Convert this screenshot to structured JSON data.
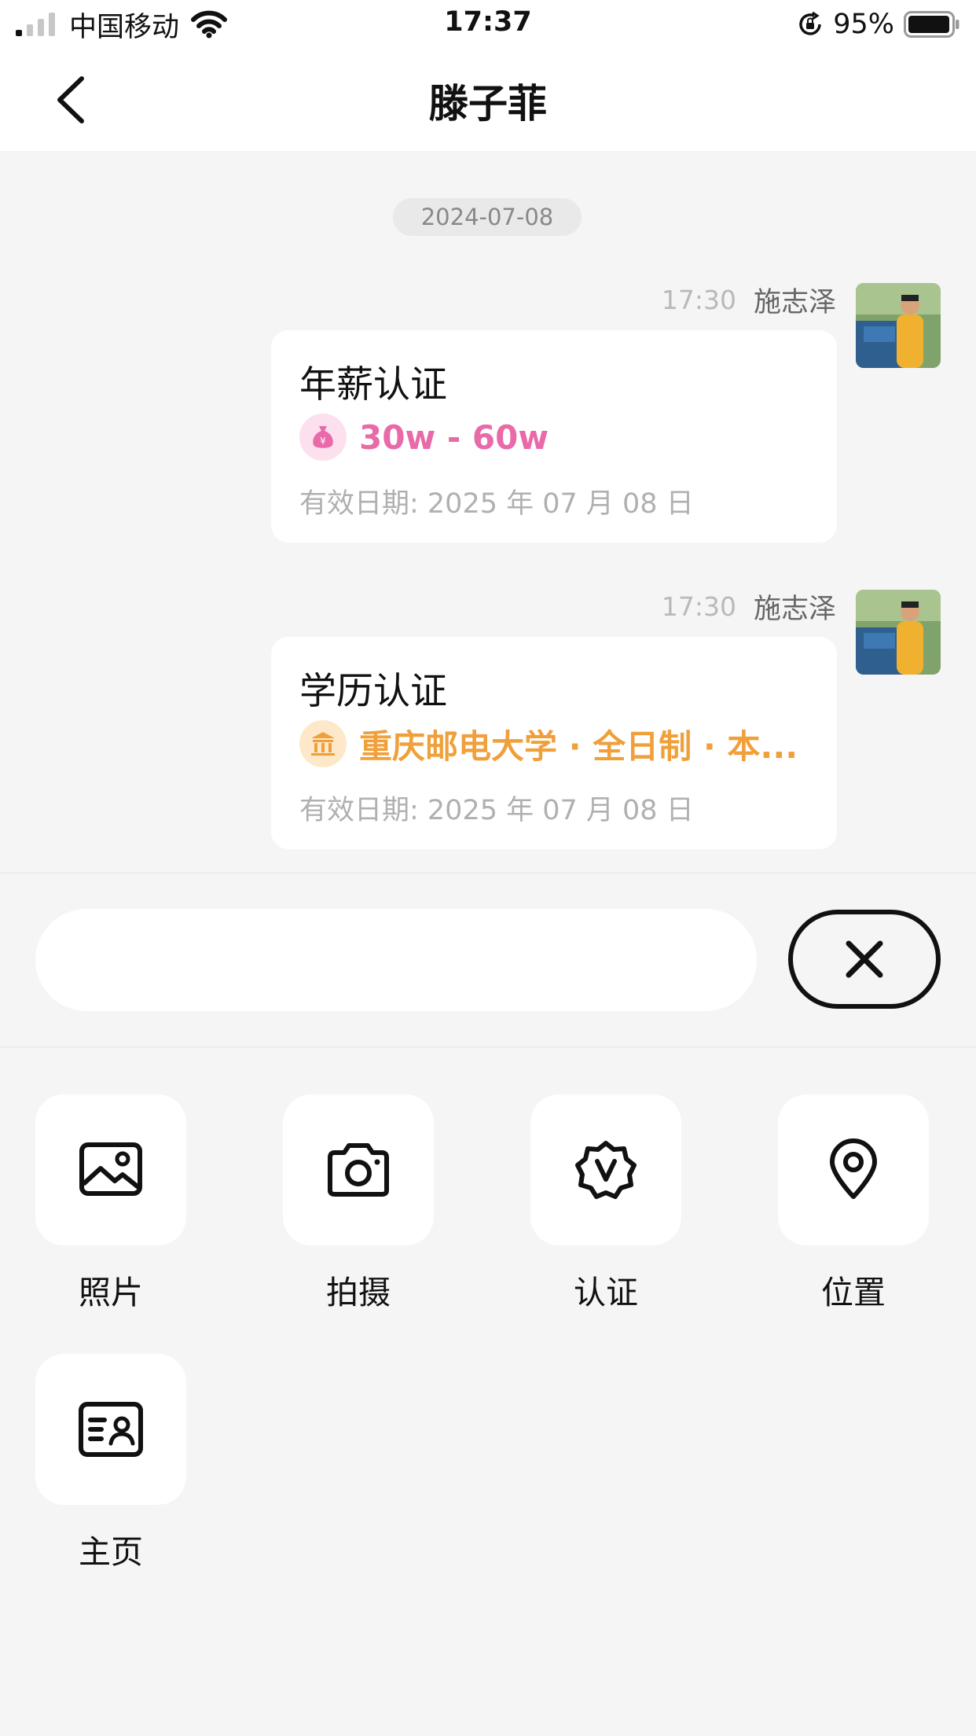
{
  "status_bar": {
    "carrier": "中国移动",
    "time": "17:37",
    "battery": "95%"
  },
  "header": {
    "title": "滕子菲"
  },
  "chat": {
    "date": "2024-07-08",
    "messages": [
      {
        "time": "17:30",
        "sender": "施志泽",
        "card_title": "年薪认证",
        "badge_text": "30w - 60w",
        "badge_icon": "money-bag-icon",
        "badge_color": "#e96aa8",
        "valid_text": "有效日期: 2025 年 07 月 08 日"
      },
      {
        "time": "17:30",
        "sender": "施志泽",
        "card_title": "学历认证",
        "badge_text": "重庆邮电大学 · 全日制 · 本...",
        "badge_icon": "institution-icon",
        "badge_color": "#f0a03a",
        "valid_text": "有效日期: 2025 年 07 月 08 日"
      }
    ]
  },
  "input": {
    "placeholder": ""
  },
  "tools": [
    {
      "label": "照片",
      "icon": "photo-icon"
    },
    {
      "label": "拍摄",
      "icon": "camera-icon"
    },
    {
      "label": "认证",
      "icon": "verified-badge-icon"
    },
    {
      "label": "位置",
      "icon": "location-pin-icon"
    },
    {
      "label": "主页",
      "icon": "profile-card-icon"
    }
  ]
}
